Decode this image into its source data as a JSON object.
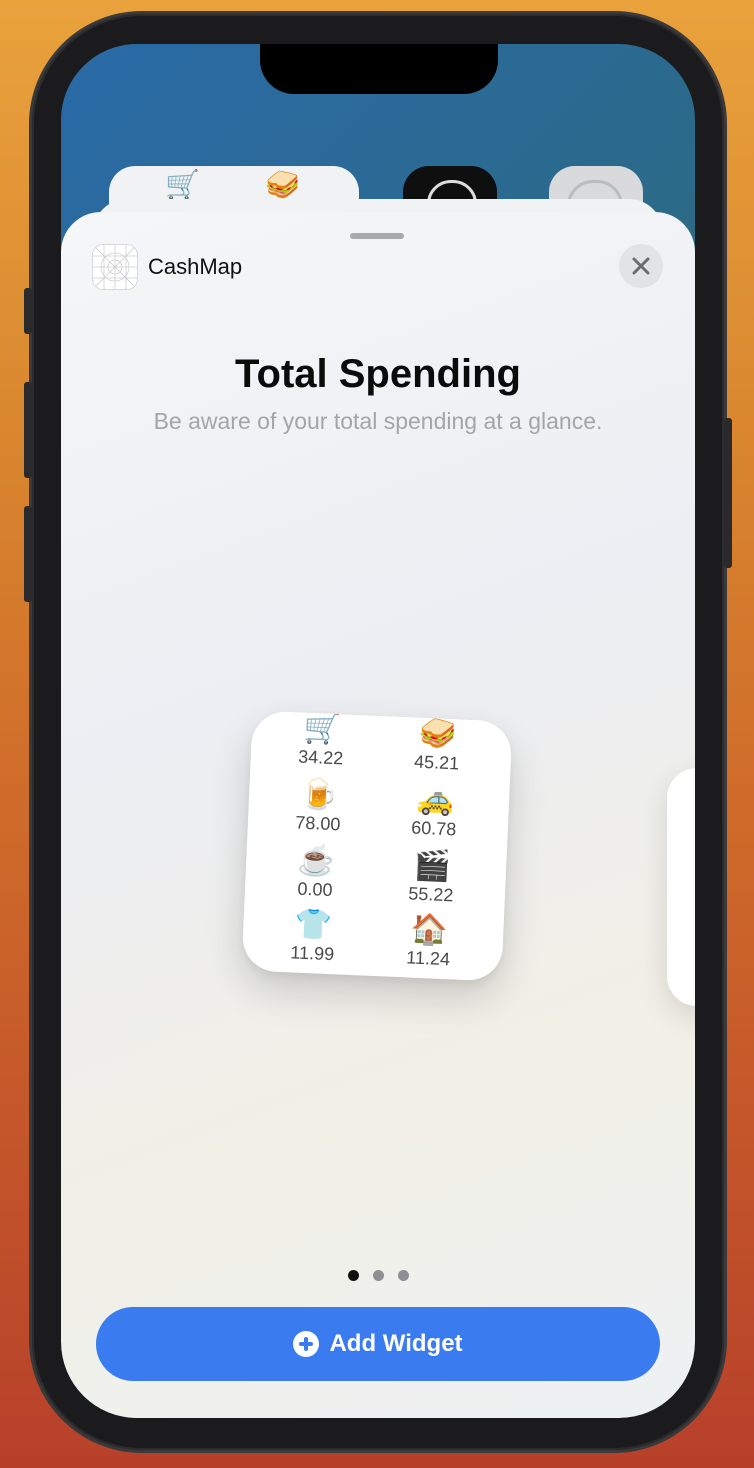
{
  "app": {
    "name": "CashMap",
    "close_icon": "close-icon"
  },
  "sheet": {
    "title": "Total Spending",
    "subtitle": "Be aware of your total spending at a glance."
  },
  "widget": {
    "items": [
      {
        "icon": "🛒",
        "value": "34.22"
      },
      {
        "icon": "🥪",
        "value": "45.21"
      },
      {
        "icon": "🍺",
        "value": "78.00"
      },
      {
        "icon": "🚕",
        "value": "60.78"
      },
      {
        "icon": "☕",
        "value": "0.00"
      },
      {
        "icon": "🎬",
        "value": "55.22"
      },
      {
        "icon": "👕",
        "value": "11.99"
      },
      {
        "icon": "🏠",
        "value": "11.24"
      }
    ]
  },
  "background_widget": {
    "icons": [
      "🛒",
      "🥪"
    ]
  },
  "pager": {
    "count": 3,
    "active": 0
  },
  "add_button": {
    "label": "Add Widget"
  },
  "colors": {
    "accent": "#3a7bf0",
    "title": "#0b0b0c",
    "subtitle": "#a3a5aa"
  }
}
